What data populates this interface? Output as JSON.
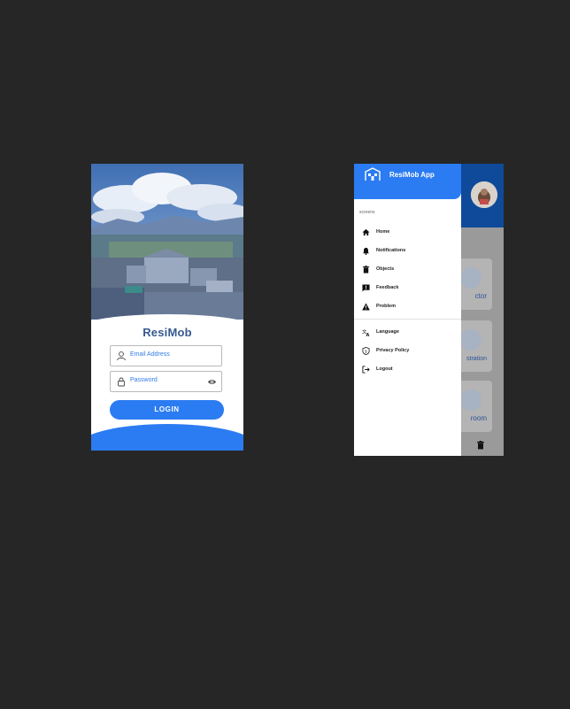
{
  "login": {
    "brand": "ResiMob",
    "email_placeholder": "Email Address",
    "password_placeholder": "Password",
    "login_label": "LOGIN"
  },
  "drawer": {
    "app_title": "ResiMob App",
    "section_label": "screens",
    "items": [
      {
        "label": "Home",
        "icon": "home-icon"
      },
      {
        "label": "Notifications",
        "icon": "bell-icon"
      },
      {
        "label": "Objects",
        "icon": "trash-icon"
      },
      {
        "label": "Feedback",
        "icon": "feedback-icon"
      },
      {
        "label": "Problem",
        "icon": "warning-icon"
      }
    ],
    "secondary_items": [
      {
        "label": "Language",
        "icon": "translate-icon"
      },
      {
        "label": "Privacy Policy",
        "icon": "shield-icon"
      },
      {
        "label": "Logout",
        "icon": "logout-icon"
      }
    ]
  },
  "background_cards": [
    {
      "label": "ctor"
    },
    {
      "label": "stration"
    },
    {
      "label": "room"
    }
  ],
  "colors": {
    "page_bg": "#262626",
    "primary": "#2b7cf2",
    "brand_text": "#355a8f",
    "header_dark": "#0f4a9a"
  }
}
